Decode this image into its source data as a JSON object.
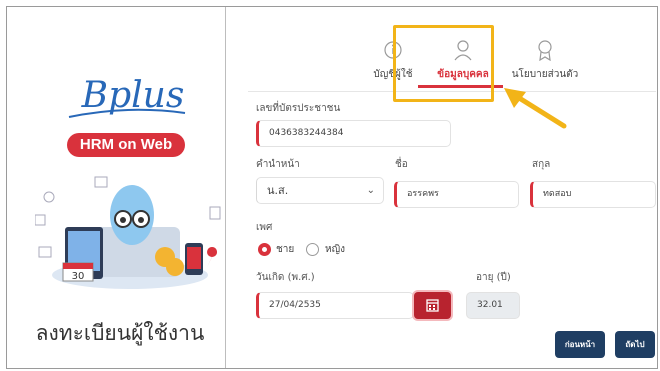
{
  "brand": {
    "logo_text": "Bplus",
    "badge": "HRM on Web",
    "register_title": "ลงทะเบียนผู้ใช้งาน",
    "calendar_date": "30"
  },
  "steps": [
    {
      "label": "บัญชีผู้ใช้",
      "icon": "info-circle-icon"
    },
    {
      "label": "ข้อมูลบุคคล",
      "icon": "user-icon",
      "active": true
    },
    {
      "label": "นโยบายส่วนตัว",
      "icon": "award-icon"
    }
  ],
  "form": {
    "id_card": {
      "label": "เลขที่บัตรประชาชน",
      "value": "0436383244384"
    },
    "prefix": {
      "label": "คำนำหน้า",
      "value": "น.ส."
    },
    "first_name": {
      "label": "ชื่อ",
      "value": "อรรคพร"
    },
    "last_name": {
      "label": "สกุล",
      "value": "ทดสอบ"
    },
    "gender": {
      "label": "เพศ",
      "options": [
        "ชาย",
        "หญิง"
      ],
      "selected": "ชาย"
    },
    "birthdate": {
      "label": "วันเกิด (พ.ศ.)",
      "value": "27/04/2535"
    },
    "age": {
      "label": "อายุ (ปี)",
      "value": "32.01"
    }
  },
  "buttons": {
    "back": "ก่อนหน้า",
    "next": "ถัดไป"
  },
  "colors": {
    "accent": "#d9323c",
    "primary": "#1f3e63",
    "highlight": "#f2b418",
    "brand_blue": "#2868b8"
  }
}
